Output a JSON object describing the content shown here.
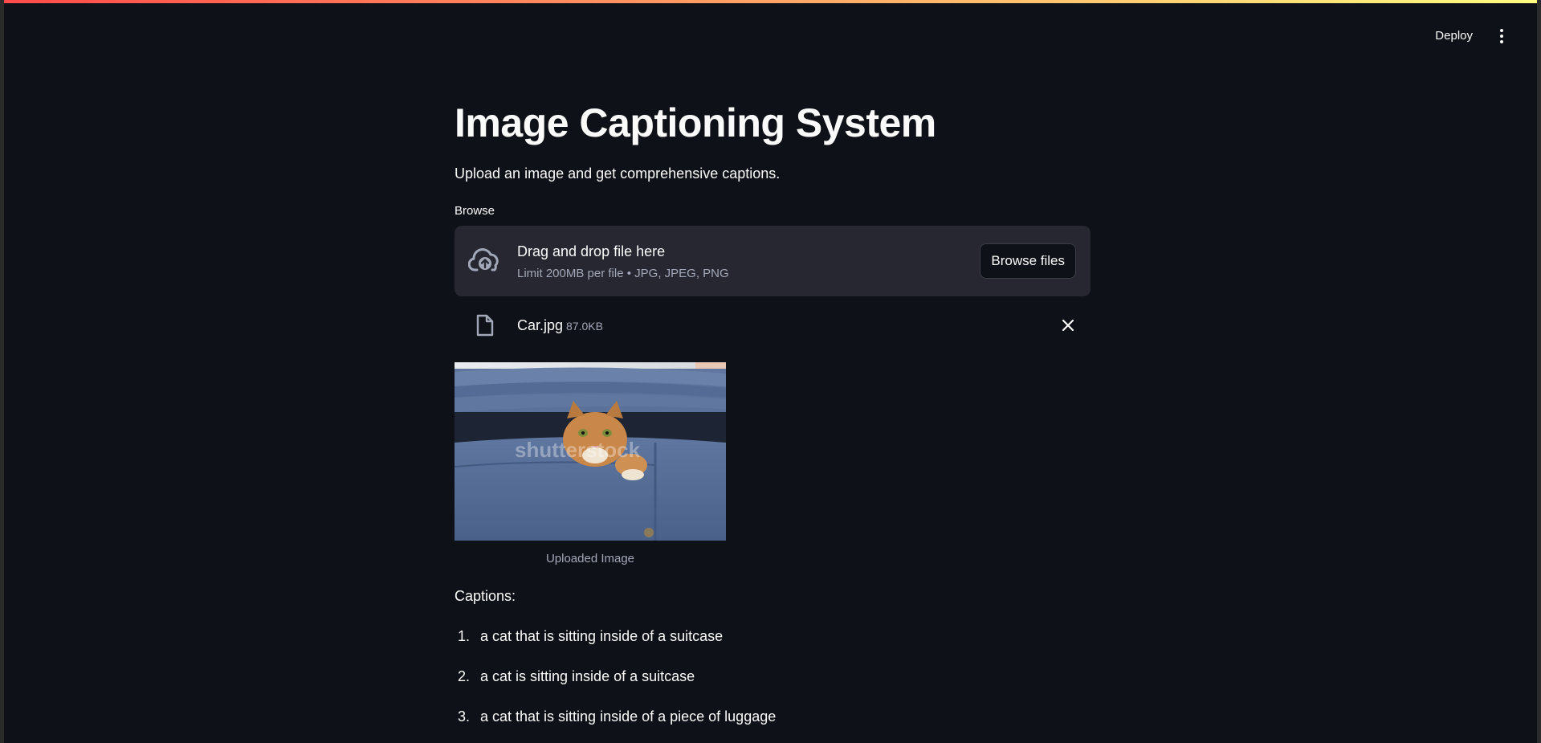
{
  "toolbar": {
    "deploy_label": "Deploy",
    "menu_icon": "kebab-menu-icon"
  },
  "page": {
    "title": "Image Captioning System",
    "subtitle": "Upload an image and get comprehensive captions."
  },
  "uploader": {
    "label": "Browse",
    "drop_title": "Drag and drop file here",
    "drop_limit": "Limit 200MB per file • JPG, JPEG, PNG",
    "browse_button": "Browse files",
    "upload_icon": "cloud-upload-icon"
  },
  "file": {
    "name": "Car.jpg",
    "size": "87.0KB",
    "icon": "file-icon",
    "remove_icon": "close-icon"
  },
  "image": {
    "caption": "Uploaded Image",
    "watermark": "shutterstock"
  },
  "results": {
    "heading": "Captions:",
    "items": [
      {
        "num": "1.",
        "text": "a cat that is sitting inside of a suitcase"
      },
      {
        "num": "2.",
        "text": "a cat is sitting inside of a suitcase"
      },
      {
        "num": "3.",
        "text": "a cat that is sitting inside of a piece of luggage"
      }
    ]
  },
  "colors": {
    "background": "#0e1117",
    "surface": "#262730",
    "text": "#fafafa",
    "muted": "#a3a8b8"
  }
}
